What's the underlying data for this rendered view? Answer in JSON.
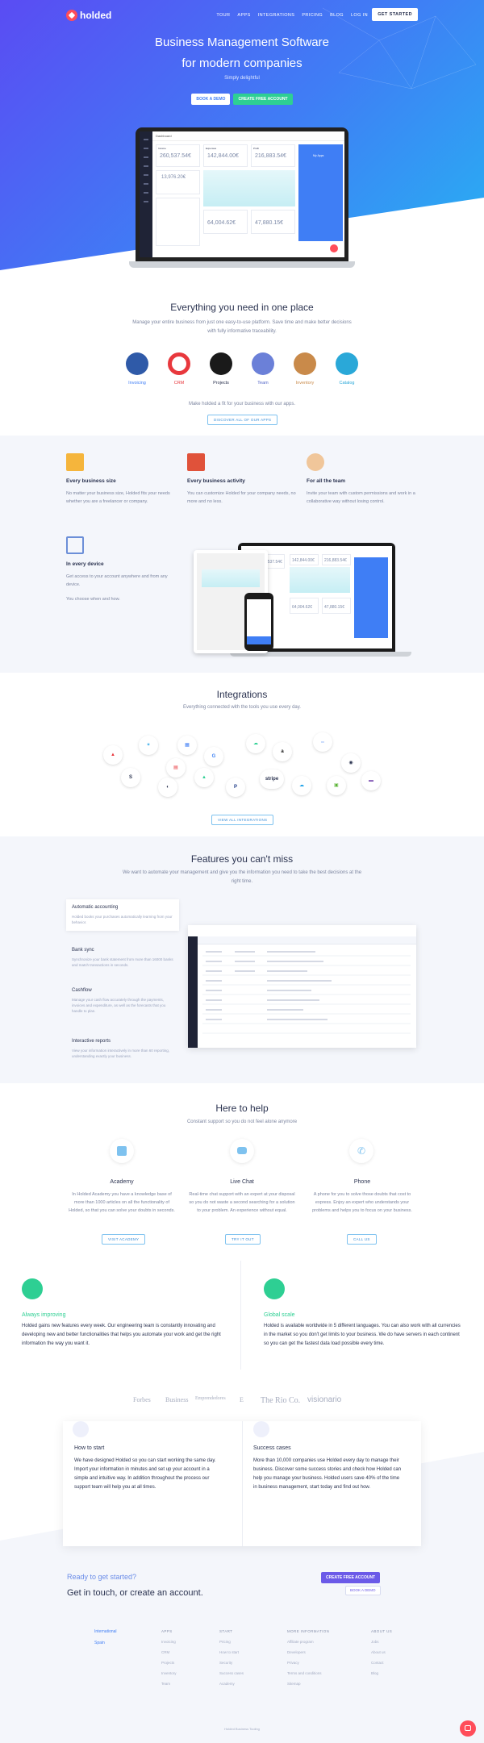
{
  "brand": {
    "name": "holded"
  },
  "nav": {
    "links": [
      "TOUR",
      "APPS",
      "INTEGRATIONS",
      "PRICING",
      "BLOG",
      "LOG IN"
    ],
    "cta": "GET STARTED"
  },
  "hero": {
    "title_line1": "Business Management Software",
    "title_line2": "for modern companies",
    "subtitle": "Simply delightful",
    "btn_demo": "BOOK A DEMO",
    "btn_create": "CREATE FREE ACCOUNT"
  },
  "dashboard": {
    "tab": "Dashboard",
    "income": "Income",
    "expenses": "Expenses",
    "profit": "Profit",
    "v1": "260,537.54€",
    "v2": "142,844.00€",
    "v3": "216,883.54€",
    "v4": "13,976.20€",
    "v5": "64,004.62€",
    "v6": "47,880.15€",
    "panel_title": "My Apps"
  },
  "everything": {
    "title": "Everything you need in one place",
    "desc": "Manage your entire business from just one easy-to-use platform. Save time and make better decisions with fully informative traceability.",
    "apps": [
      "Invoicing",
      "CRM",
      "Projects",
      "Team",
      "Inventory",
      "Catalog"
    ],
    "note": "Make holded a fit for your business with our apps.",
    "btn": "DISCOVER ALL OF OUR APPS"
  },
  "benefits": [
    {
      "title": "Every business size",
      "desc": "No matter your business size, Holded fits your needs whether you are a freelancer or company."
    },
    {
      "title": "Every business activity",
      "desc": "You can customize Holded for your company needs, no more and no less."
    },
    {
      "title": "For all the team",
      "desc": "Invite your team with custom permissions and work in a collaborative way without losing control."
    },
    {
      "title": "In every device",
      "desc": "Get access to your account anywhere and from any device.",
      "desc2": "You choose when and how."
    }
  ],
  "integrations": {
    "title": "Integrations",
    "desc": "Everything connected with the tools you use every day.",
    "logos": [
      "amazon",
      "stripe",
      "G",
      "S",
      "P"
    ],
    "btn": "VIEW ALL INTEGRATIONS"
  },
  "features": {
    "title": "Features you can't miss",
    "desc": "We want to automate your management and give you the information you need to take the best decisions at the right time.",
    "items": [
      {
        "title": "Automatic accounting",
        "desc": "Holded books your purchases automatically learning from your behavior."
      },
      {
        "title": "Bank sync",
        "desc": "Synchronize your bank statement from more than 16000 banks and match transactions in seconds."
      },
      {
        "title": "Cashflow",
        "desc": "Manage your cash flow accurately through the payments, invoices and expenditure, as well as the forecasts that you handle to plan."
      },
      {
        "title": "Interactive reports",
        "desc": "View your information interactively in more than 60 reporting, understanding exactly your business."
      }
    ]
  },
  "help": {
    "title": "Here to help",
    "desc": "Constant support so you do not feel alone anymore",
    "items": [
      {
        "title": "Academy",
        "desc": "In Holded Academy you have a knowledge base of more than 1000 articles on all the functionality of Holded, so that you can solve your doubts in seconds.",
        "btn": "VISIT ACADEMY"
      },
      {
        "title": "Live Chat",
        "desc": "Real-time chat support with an expert at your disposal so you do not waste a second searching for a solution to your problem. An experience without equal.",
        "btn": "TRY IT OUT"
      },
      {
        "title": "Phone",
        "desc": "A phone for you to solve those doubts that cost to express. Enjoy an expert who understands your problems and helps you to focus on your business.",
        "btn": "CALL US"
      }
    ]
  },
  "always": {
    "title": "Always improving",
    "desc": "Holded gains new features every week. Our engineering team is constantly innovating and developing new and better functionalities that helps you automate your work and get the right information the way you want it."
  },
  "global": {
    "title": "Global scale",
    "desc": "Holded is available worldwide in 5 different languages. You can also work with all currencies in the market so you don't get limits to your business. We do have servers in each continent so you can get the fastest data load possible every time."
  },
  "press": [
    "Forbes",
    "Business",
    "Emprendedores",
    "E",
    "The Rio Co.",
    "visionario"
  ],
  "howto": {
    "title": "How to start",
    "desc": "We have designed Holded so you can start working the same day. Import your information in minutes and set up your account in a simple and intuitive way. In addition throughout the process our support team will help you at all times."
  },
  "success": {
    "title": "Success cases",
    "desc": "More than 10,000 companies use Holded every day to manage their business. Discover some success stories and check how Holded can help you manage your business. Holded users save 40% of the time in business management, start today and find out how."
  },
  "cta": {
    "ready": "Ready to get started?",
    "line": "Get in touch, or create an account.",
    "btn_create": "CREATE FREE ACCOUNT",
    "btn_demo": "BOOK A DEMO"
  },
  "footer": {
    "lang": [
      "International",
      "Spain"
    ],
    "cols": [
      {
        "head": "APPS",
        "items": [
          "Invoicing",
          "CRM",
          "Projects",
          "Inventory",
          "Team"
        ]
      },
      {
        "head": "START",
        "items": [
          "Pricing",
          "How to start",
          "Security",
          "Success cases",
          "Academy"
        ]
      },
      {
        "head": "MORE INFORMATION",
        "items": [
          "Affiliate program",
          "Developers",
          "Privacy",
          "Terms and conditions",
          "Sitemap"
        ]
      },
      {
        "head": "ABOUT US",
        "items": [
          "Jobs",
          "About us",
          "Contact",
          "Blog"
        ]
      }
    ],
    "copy": "Holded Business Tooling"
  },
  "colors": {
    "primary": "#3f7ef5",
    "accent": "#2ecf93",
    "brand": "#ff4d5a"
  }
}
